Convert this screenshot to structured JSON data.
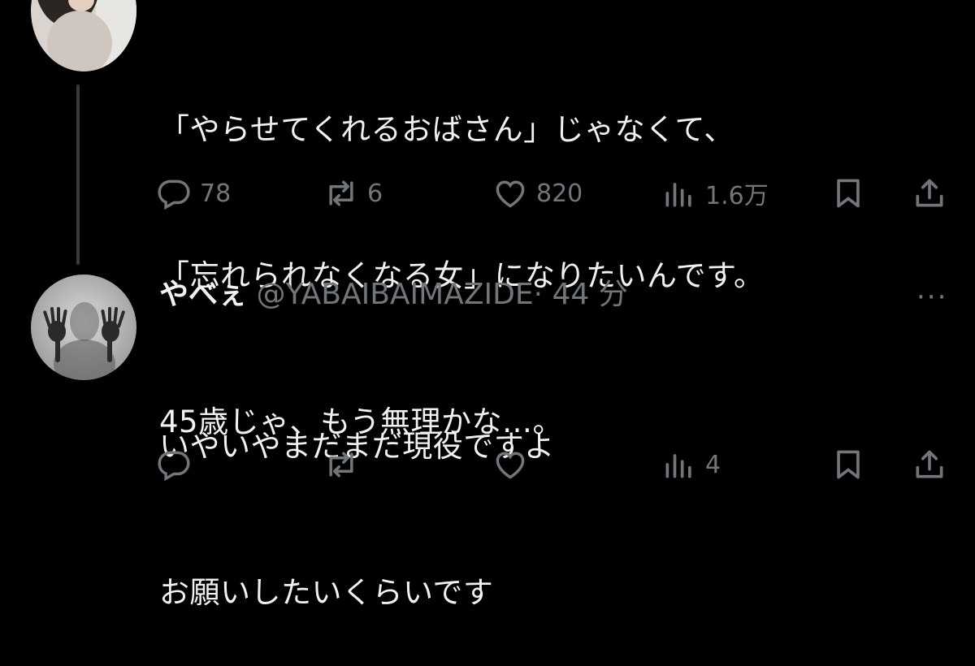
{
  "first_tweet": {
    "text_lines": [
      "「やらせてくれるおばさん」じゃなくて、",
      "「忘れられなくなる女」になりたいんです。",
      "45歳じゃ、もう無理かな…。"
    ],
    "actions": {
      "replies": "78",
      "retweets": "6",
      "likes": "820",
      "views": "1.6万"
    }
  },
  "reply_tweet": {
    "display_name": "やべぇ",
    "handle": "@YABAIBAIMAZIDE",
    "separator": "·",
    "time": "44 分",
    "more": "···",
    "text_lines": [
      "いやいやまだまだ現役ですよ",
      "お願いしたいくらいです"
    ],
    "actions": {
      "replies": "",
      "retweets": "",
      "likes": "",
      "views": "4"
    }
  },
  "icons": [
    "reply-icon",
    "retweet-icon",
    "like-icon",
    "views-icon",
    "bookmark-icon",
    "share-icon",
    "more-icon"
  ],
  "colors": {
    "background": "#000000",
    "text": "#e7e9ea",
    "muted": "#71767b",
    "thread_line": "#3a3a3a"
  }
}
